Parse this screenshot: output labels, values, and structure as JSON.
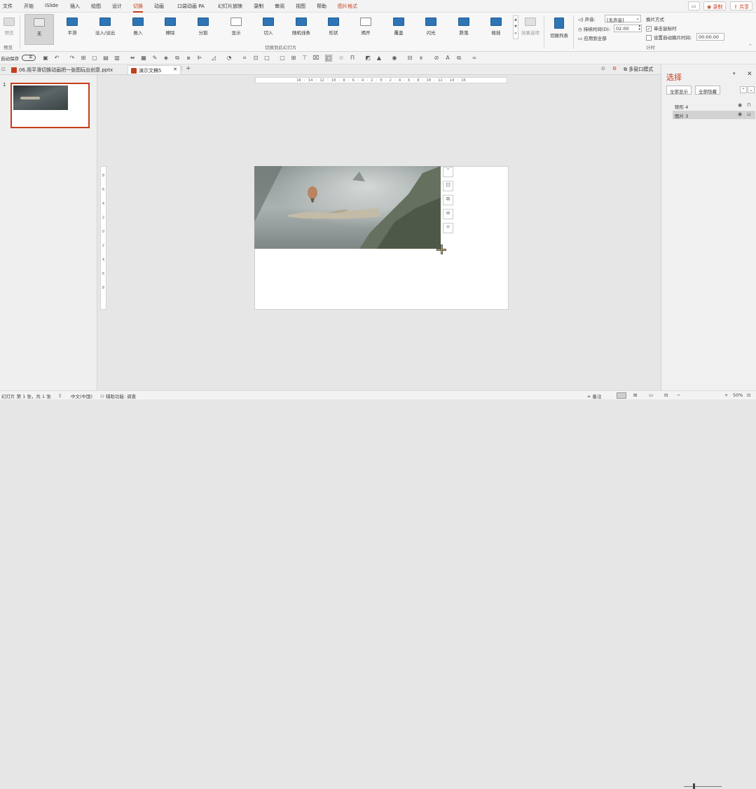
{
  "menubar": {
    "items": [
      "文件",
      "开始",
      "iSlide",
      "插入",
      "绘图",
      "设计",
      "切换",
      "动画",
      "口袋动画 PA",
      "幻灯片放映",
      "录制",
      "审阅",
      "视图",
      "帮助",
      "图片格式"
    ],
    "active": "切换",
    "record_label": "录制",
    "share_label": "共享"
  },
  "ribbon": {
    "preview_label": "预览",
    "preview_group": "预览",
    "transitions": [
      "无",
      "平滑",
      "淡入/淡出",
      "推入",
      "擦除",
      "分割",
      "显示",
      "切入",
      "随机线条",
      "形状",
      "揭开",
      "覆盖",
      "闪光",
      "跌落",
      "棱挂"
    ],
    "effect_options": "效果选项",
    "transitions_group": "切换到此幻灯片",
    "switch_list": "切换列表",
    "sound_label": "声音:",
    "sound_value": "[无声音]",
    "duration_label": "持续时间(D):",
    "duration_value": "02.00",
    "apply_all": "应用到全部",
    "advance_title": "换片方式",
    "on_click": "单击鼠标时",
    "after_time": "设置自动换片时间:",
    "after_value": "00:00.00",
    "timing_group": "计时"
  },
  "qat": {
    "autosave_label": "自动保存",
    "autosave_state": "关"
  },
  "doc_tabs": {
    "tab1": "06.用平滑切换动画把一张图玩出创意.pptx",
    "tab2": "演示文稿5",
    "multi_window": "多窗口模式"
  },
  "ruler": {
    "h_ticks": "16 · 14 · 12 · 10 · 8 · 6 · 4 · 2 · 0 · 2 · 4 · 6 · 8 · 10 · 12 · 14 · 16",
    "v_ticks": [
      "8",
      "6",
      "4",
      "2",
      "0",
      "2",
      "4",
      "6",
      "8"
    ]
  },
  "thumbnails": {
    "slide_number": "1"
  },
  "selection_pane": {
    "title": "选择",
    "show_all": "全部显示",
    "hide_all": "全部隐藏",
    "items": [
      "矩形 4",
      "图片 3"
    ]
  },
  "status": {
    "slide_info": "幻灯片 第 1 张，共 1 张",
    "language": "中文(中国)",
    "accessibility": "辅助功能: 调查",
    "notes": "备注",
    "zoom": "50%"
  },
  "colors": {
    "accent": "#c43e1c",
    "ribbon_bg": "#f7f7f7",
    "canvas_bg": "#e6e6e6"
  }
}
